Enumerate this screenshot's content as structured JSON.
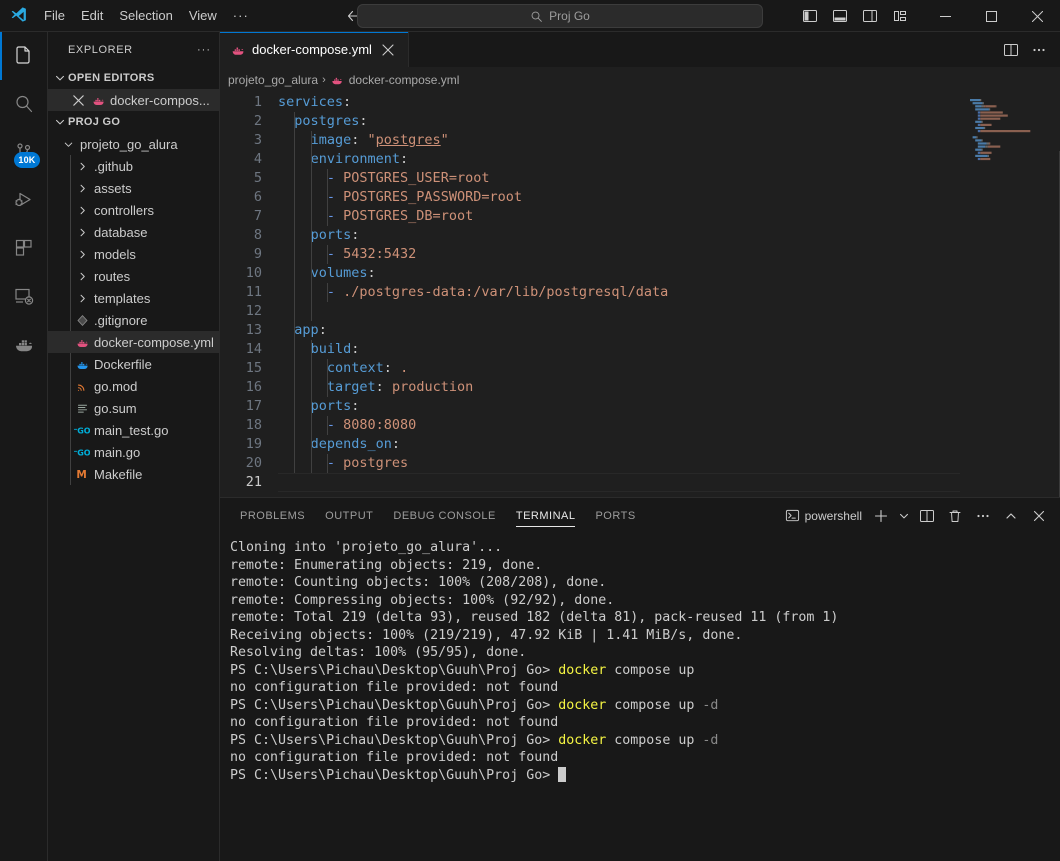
{
  "titlebar": {
    "logo_icon": "vscode-logo-icon",
    "menu": [
      "File",
      "Edit",
      "Selection",
      "View"
    ],
    "menu_more": "···",
    "nav_back_icon": "arrow-left-icon",
    "nav_forward_icon": "arrow-right-icon",
    "search": {
      "icon": "search-icon",
      "value": "Proj Go",
      "placeholder": "Search"
    },
    "layout_buttons": [
      {
        "name": "toggle-primary-sidebar",
        "icon": "layout-sidebar-left-icon"
      },
      {
        "name": "toggle-panel",
        "icon": "layout-panel-icon"
      },
      {
        "name": "toggle-secondary-sidebar",
        "icon": "layout-sidebar-right-icon"
      },
      {
        "name": "customize-layout",
        "icon": "layout-customize-icon"
      }
    ],
    "window_controls": [
      {
        "name": "minimize-button",
        "glyph": "─"
      },
      {
        "name": "maximize-button",
        "glyph": "□"
      },
      {
        "name": "close-button",
        "glyph": "✕"
      }
    ]
  },
  "activitybar": {
    "items": [
      {
        "name": "explorer",
        "icon": "files-icon",
        "active": true,
        "badge": ""
      },
      {
        "name": "search",
        "icon": "search-icon",
        "active": false,
        "badge": ""
      },
      {
        "name": "source-control",
        "icon": "source-control-icon",
        "active": false,
        "badge": "10K"
      },
      {
        "name": "run-and-debug",
        "icon": "debug-icon",
        "active": false,
        "badge": ""
      },
      {
        "name": "extensions",
        "icon": "extensions-icon",
        "active": false,
        "badge": ""
      },
      {
        "name": "remote-explorer",
        "icon": "remote-explorer-icon",
        "active": false,
        "badge": ""
      },
      {
        "name": "docker",
        "icon": "docker-whale-icon",
        "active": false,
        "badge": ""
      }
    ]
  },
  "sidebar": {
    "title": "EXPLORER",
    "more_actions": "···",
    "open_editors": {
      "label": "OPEN EDITORS",
      "items": [
        {
          "label": "docker-compos...",
          "icon": "docker-file-icon",
          "close": "✕",
          "selected": true
        }
      ]
    },
    "folder": {
      "label": "PROJ GO",
      "root": {
        "label": "projeto_go_alura",
        "expanded": true
      },
      "items": [
        {
          "label": ".github",
          "type": "folder",
          "icon": "chevron-right-icon"
        },
        {
          "label": "assets",
          "type": "folder",
          "icon": "chevron-right-icon"
        },
        {
          "label": "controllers",
          "type": "folder",
          "icon": "chevron-right-icon"
        },
        {
          "label": "database",
          "type": "folder",
          "icon": "chevron-right-icon"
        },
        {
          "label": "models",
          "type": "folder",
          "icon": "chevron-right-icon"
        },
        {
          "label": "routes",
          "type": "folder",
          "icon": "chevron-right-icon"
        },
        {
          "label": "templates",
          "type": "folder",
          "icon": "chevron-right-icon"
        },
        {
          "label": ".gitignore",
          "type": "file",
          "icon": "gitignore-icon"
        },
        {
          "label": "docker-compose.yml",
          "type": "file",
          "icon": "docker-compose-icon",
          "selected": true
        },
        {
          "label": "Dockerfile",
          "type": "file",
          "icon": "dockerfile-icon"
        },
        {
          "label": "go.mod",
          "type": "file",
          "icon": "gomod-icon"
        },
        {
          "label": "go.sum",
          "type": "file",
          "icon": "gosum-icon"
        },
        {
          "label": "main_test.go",
          "type": "file",
          "icon": "go-icon"
        },
        {
          "label": "main.go",
          "type": "file",
          "icon": "go-icon"
        },
        {
          "label": "Makefile",
          "type": "file",
          "icon": "makefile-icon"
        }
      ]
    }
  },
  "editor": {
    "tabs": [
      {
        "label": "docker-compose.yml",
        "icon": "docker-compose-icon",
        "active": true,
        "close": "✕"
      }
    ],
    "actions": [
      {
        "name": "split-editor-right-button",
        "icon": "split-editor-icon"
      },
      {
        "name": "editor-more-actions-button",
        "icon": "ellipsis-icon"
      }
    ],
    "breadcrumb": [
      {
        "label": "projeto_go_alura",
        "icon": ""
      },
      {
        "label": "docker-compose.yml",
        "icon": "docker-compose-icon"
      }
    ],
    "breadcrumb_separator": "›",
    "active_line": 21,
    "lines": [
      {
        "n": 1,
        "indent": 0,
        "tokens": [
          {
            "t": "services",
            "c": "k-key"
          },
          {
            "t": ":",
            "c": "k-punct"
          }
        ]
      },
      {
        "n": 2,
        "indent": 1,
        "tokens": [
          {
            "t": "postgres",
            "c": "k-key"
          },
          {
            "t": ":",
            "c": "k-punct"
          }
        ]
      },
      {
        "n": 3,
        "indent": 2,
        "tokens": [
          {
            "t": "image",
            "c": "k-key"
          },
          {
            "t": ": ",
            "c": "k-punct"
          },
          {
            "t": "\"",
            "c": "k-str"
          },
          {
            "t": "postgres",
            "c": "k-strq"
          },
          {
            "t": "\"",
            "c": "k-str"
          }
        ]
      },
      {
        "n": 4,
        "indent": 2,
        "tokens": [
          {
            "t": "environment",
            "c": "k-key"
          },
          {
            "t": ":",
            "c": "k-punct"
          }
        ]
      },
      {
        "n": 5,
        "indent": 3,
        "tokens": [
          {
            "t": "- ",
            "c": "k-dash"
          },
          {
            "t": "POSTGRES_USER=root",
            "c": "k-val"
          }
        ]
      },
      {
        "n": 6,
        "indent": 3,
        "tokens": [
          {
            "t": "- ",
            "c": "k-dash"
          },
          {
            "t": "POSTGRES_PASSWORD=root",
            "c": "k-val"
          }
        ]
      },
      {
        "n": 7,
        "indent": 3,
        "tokens": [
          {
            "t": "- ",
            "c": "k-dash"
          },
          {
            "t": "POSTGRES_DB=root",
            "c": "k-val"
          }
        ]
      },
      {
        "n": 8,
        "indent": 2,
        "tokens": [
          {
            "t": "ports",
            "c": "k-key"
          },
          {
            "t": ":",
            "c": "k-punct"
          }
        ]
      },
      {
        "n": 9,
        "indent": 3,
        "tokens": [
          {
            "t": "- ",
            "c": "k-dash"
          },
          {
            "t": "5432:5432",
            "c": "k-val"
          }
        ]
      },
      {
        "n": 10,
        "indent": 2,
        "tokens": [
          {
            "t": "volumes",
            "c": "k-key"
          },
          {
            "t": ":",
            "c": "k-punct"
          }
        ]
      },
      {
        "n": 11,
        "indent": 3,
        "tokens": [
          {
            "t": "- ",
            "c": "k-dash"
          },
          {
            "t": "./postgres-data:/var/lib/postgresql/data",
            "c": "k-val"
          }
        ]
      },
      {
        "n": 12,
        "indent": 0,
        "tokens": []
      },
      {
        "n": 13,
        "indent": 1,
        "tokens": [
          {
            "t": "app",
            "c": "k-key"
          },
          {
            "t": ":",
            "c": "k-punct"
          }
        ]
      },
      {
        "n": 14,
        "indent": 2,
        "tokens": [
          {
            "t": "build",
            "c": "k-key"
          },
          {
            "t": ":",
            "c": "k-punct"
          }
        ]
      },
      {
        "n": 15,
        "indent": 3,
        "tokens": [
          {
            "t": "context",
            "c": "k-key"
          },
          {
            "t": ": ",
            "c": "k-punct"
          },
          {
            "t": ".",
            "c": "k-val"
          }
        ]
      },
      {
        "n": 16,
        "indent": 3,
        "tokens": [
          {
            "t": "target",
            "c": "k-key"
          },
          {
            "t": ": ",
            "c": "k-punct"
          },
          {
            "t": "production",
            "c": "k-val"
          }
        ]
      },
      {
        "n": 17,
        "indent": 2,
        "tokens": [
          {
            "t": "ports",
            "c": "k-key"
          },
          {
            "t": ":",
            "c": "k-punct"
          }
        ]
      },
      {
        "n": 18,
        "indent": 3,
        "tokens": [
          {
            "t": "- ",
            "c": "k-dash"
          },
          {
            "t": "8080:8080",
            "c": "k-val"
          }
        ]
      },
      {
        "n": 19,
        "indent": 2,
        "tokens": [
          {
            "t": "depends_on",
            "c": "k-key"
          },
          {
            "t": ":",
            "c": "k-punct"
          }
        ]
      },
      {
        "n": 20,
        "indent": 3,
        "tokens": [
          {
            "t": "- ",
            "c": "k-dash"
          },
          {
            "t": "postgres",
            "c": "k-val"
          }
        ]
      },
      {
        "n": 21,
        "indent": 0,
        "tokens": []
      }
    ]
  },
  "panel": {
    "tabs": [
      {
        "label": "PROBLEMS",
        "active": false
      },
      {
        "label": "OUTPUT",
        "active": false
      },
      {
        "label": "DEBUG CONSOLE",
        "active": false
      },
      {
        "label": "TERMINAL",
        "active": true
      },
      {
        "label": "PORTS",
        "active": false
      }
    ],
    "terminal_name": "powershell",
    "terminal_icon": "terminal-powershell-icon",
    "actions": [
      {
        "name": "new-terminal-button",
        "icon": "plus-icon"
      },
      {
        "name": "terminal-profile-dropdown",
        "icon": "chevron-down-icon"
      },
      {
        "name": "split-terminal-button",
        "icon": "split-icon"
      },
      {
        "name": "kill-terminal-button",
        "icon": "trash-icon"
      },
      {
        "name": "panel-more-actions-button",
        "icon": "ellipsis-icon"
      },
      {
        "name": "maximize-panel-button",
        "icon": "chevron-up-icon"
      },
      {
        "name": "close-panel-button",
        "icon": "close-icon"
      }
    ],
    "terminal_lines": [
      [
        {
          "t": "Cloning into 'projeto_go_alura'...",
          "c": "t-ps"
        }
      ],
      [
        {
          "t": "remote: Enumerating objects: 219, done.",
          "c": "t-ps"
        }
      ],
      [
        {
          "t": "remote: Counting objects: 100% (208/208), done.",
          "c": "t-ps"
        }
      ],
      [
        {
          "t": "remote: Compressing objects: 100% (92/92), done.",
          "c": "t-ps"
        }
      ],
      [
        {
          "t": "remote: Total 219 (delta 93), reused 182 (delta 81), pack-reused 11 (from 1)",
          "c": "t-ps"
        }
      ],
      [
        {
          "t": "Receiving objects: 100% (219/219), 47.92 KiB | 1.41 MiB/s, done.",
          "c": "t-ps"
        }
      ],
      [
        {
          "t": "Resolving deltas: 100% (95/95), done.",
          "c": "t-ps"
        }
      ],
      [
        {
          "t": "PS C:\\Users\\Pichau\\Desktop\\Guuh\\Proj Go> ",
          "c": "t-path"
        },
        {
          "t": "docker",
          "c": "t-cmd"
        },
        {
          "t": " compose up",
          "c": "t-ps"
        }
      ],
      [
        {
          "t": "no configuration file provided: not found",
          "c": "t-ps"
        }
      ],
      [
        {
          "t": "PS C:\\Users\\Pichau\\Desktop\\Guuh\\Proj Go> ",
          "c": "t-path"
        },
        {
          "t": "docker",
          "c": "t-cmd"
        },
        {
          "t": " compose up ",
          "c": "t-ps"
        },
        {
          "t": "-d",
          "c": "t-flag"
        }
      ],
      [
        {
          "t": "no configuration file provided: not found",
          "c": "t-ps"
        }
      ],
      [
        {
          "t": "PS C:\\Users\\Pichau\\Desktop\\Guuh\\Proj Go> ",
          "c": "t-path"
        },
        {
          "t": "docker",
          "c": "t-cmd"
        },
        {
          "t": " compose up ",
          "c": "t-ps"
        },
        {
          "t": "-d",
          "c": "t-flag"
        }
      ],
      [
        {
          "t": "no configuration file provided: not found",
          "c": "t-ps"
        }
      ],
      [
        {
          "t": "PS C:\\Users\\Pichau\\Desktop\\Guuh\\Proj Go> ",
          "c": "t-path"
        },
        {
          "t": "",
          "c": "cursor"
        }
      ]
    ]
  },
  "colors": {
    "accent": "#0078d4",
    "titlebar_bg": "#181818",
    "editor_bg": "#1f1f1f",
    "sidebar_bg": "#181818",
    "yaml_key": "#569cd6",
    "yaml_string": "#ce9178",
    "yaml_dash": "#6796e6",
    "terminal_cmd": "#f5f543",
    "docker_pink": "#e2527f",
    "docker_blue": "#2496ed",
    "go_blue": "#00add8"
  }
}
